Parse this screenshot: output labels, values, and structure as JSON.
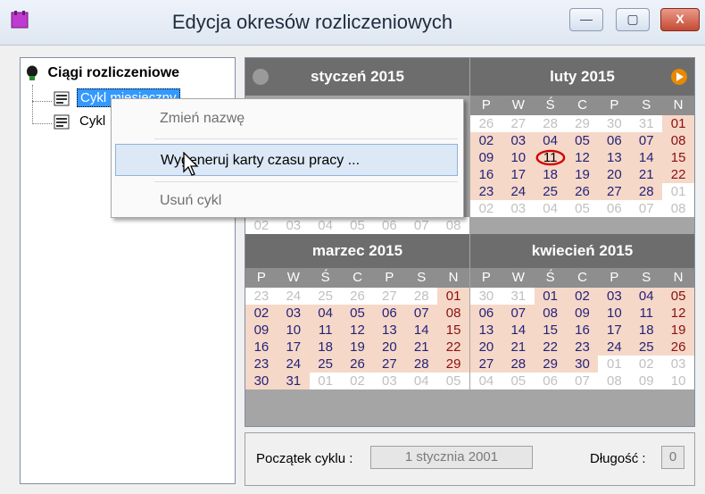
{
  "window": {
    "title": "Edycja okresów rozliczeniowych",
    "minimize_glyph": "—",
    "maximize_glyph": "▢",
    "close_glyph": "X"
  },
  "tree": {
    "root_label": "Ciągi rozliczeniowe",
    "items": [
      {
        "label": "Cykl miesięczny"
      },
      {
        "label": "Cykl"
      }
    ]
  },
  "calendar": {
    "day_headers": [
      "P",
      "W",
      "Ś",
      "C",
      "P",
      "S",
      "N"
    ],
    "nav": {
      "prev": "prev-icon",
      "next": "next-icon",
      "next_color": "#e88a00"
    },
    "months": [
      {
        "title": "styczeń 2015",
        "rows": []
      },
      {
        "title": "luty 2015",
        "rows": [
          [
            "26",
            "27",
            "28",
            "29",
            "30",
            "31",
            "01"
          ],
          [
            "02",
            "03",
            "04",
            "05",
            "06",
            "07",
            "08"
          ],
          [
            "09",
            "10",
            "11",
            "12",
            "13",
            "14",
            "15"
          ],
          [
            "16",
            "17",
            "18",
            "19",
            "20",
            "21",
            "22"
          ],
          [
            "23",
            "24",
            "25",
            "26",
            "27",
            "28",
            "01"
          ],
          [
            "02",
            "03",
            "04",
            "05",
            "06",
            "07",
            "08"
          ]
        ]
      },
      {
        "title": "marzec 2015",
        "rows": [
          [
            "23",
            "24",
            "25",
            "26",
            "27",
            "28",
            "01"
          ],
          [
            "02",
            "03",
            "04",
            "05",
            "06",
            "07",
            "08"
          ],
          [
            "09",
            "10",
            "11",
            "12",
            "13",
            "14",
            "15"
          ],
          [
            "16",
            "17",
            "18",
            "19",
            "20",
            "21",
            "22"
          ],
          [
            "23",
            "24",
            "25",
            "26",
            "27",
            "28",
            "29"
          ],
          [
            "30",
            "31",
            "01",
            "02",
            "03",
            "04",
            "05"
          ]
        ]
      },
      {
        "title": "kwiecień 2015",
        "rows": [
          [
            "30",
            "31",
            "01",
            "02",
            "03",
            "04",
            "05"
          ],
          [
            "06",
            "07",
            "08",
            "09",
            "10",
            "11",
            "12"
          ],
          [
            "13",
            "14",
            "15",
            "16",
            "17",
            "18",
            "19"
          ],
          [
            "20",
            "21",
            "22",
            "23",
            "24",
            "25",
            "26"
          ],
          [
            "27",
            "28",
            "29",
            "30",
            "01",
            "02",
            "03"
          ],
          [
            "04",
            "05",
            "06",
            "07",
            "08",
            "09",
            "10"
          ]
        ]
      }
    ],
    "jan_last_row": [
      "02",
      "03",
      "04",
      "05",
      "06",
      "07",
      "08"
    ]
  },
  "context_menu": {
    "items": [
      {
        "label": "Zmień nazwę",
        "enabled": false
      },
      {
        "label": "Wygeneruj karty czasu pracy ...",
        "enabled": true,
        "highlighted": true
      },
      {
        "label": "Usuń cykl",
        "enabled": false
      }
    ]
  },
  "bottom": {
    "start_label": "Początek cyklu :",
    "start_value": "1 stycznia 2001",
    "length_label": "Długość :",
    "length_value": "0"
  }
}
